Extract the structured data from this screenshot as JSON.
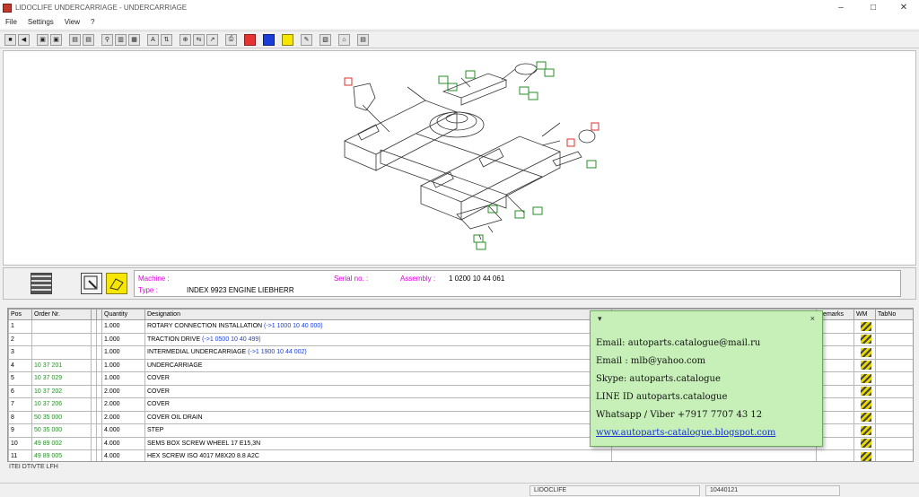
{
  "window": {
    "title": "LIDOCLIFE UNDERCARRIAGE - UNDERCARRIAGE",
    "minimize": "–",
    "maximize": "□",
    "close": "✕"
  },
  "menu": [
    "File",
    "Settings",
    "View",
    "?"
  ],
  "toolbar": {
    "groups": [
      [
        "■",
        "◀"
      ],
      [
        "▣",
        "▣"
      ],
      [
        "▤",
        "▤"
      ],
      [
        "⚲",
        "▥",
        "▦"
      ],
      [
        "A",
        "⇅"
      ],
      [
        "⊕",
        "⇆",
        "↗"
      ],
      [
        "⎙"
      ],
      [
        "red"
      ],
      [
        "blue"
      ],
      [
        "yellow"
      ],
      [
        "✎"
      ],
      [
        "▧"
      ],
      [
        "⌂"
      ],
      [
        "▤"
      ]
    ]
  },
  "info": {
    "machine_label": "Machine :",
    "machine_value": "",
    "serial_label": "Serial no. :",
    "assembly_label": "Assembly :",
    "assembly_value": "1 0200 10 44 061",
    "type_label": "Type :",
    "type_value": "INDEX 9923 ENGINE LIEBHERR"
  },
  "table": {
    "headers": [
      "Pos",
      "Order Nr.",
      "",
      "",
      "Quantity",
      "Designation",
      "",
      "Remarks",
      "WM",
      "TabNo"
    ],
    "rows": [
      {
        "pos": "1",
        "order": "",
        "qty": "1.000",
        "desc": "ROTARY CONNECTION INSTALLATION",
        "link": "(->1 1000 10 40 000)"
      },
      {
        "pos": "2",
        "order": "",
        "qty": "1.000",
        "desc": "TRACTION DRIVE",
        "link": "(->1 0500 10 40 499)"
      },
      {
        "pos": "3",
        "order": "",
        "qty": "1.000",
        "desc": "INTERMEDIAL UNDERCARRIAGE",
        "link": "(->1 1900 10 44 002)"
      },
      {
        "pos": "4",
        "order": "10 37 201",
        "qty": "1.000",
        "desc": "UNDERCARRIAGE",
        "link": ""
      },
      {
        "pos": "5",
        "order": "10 37 029",
        "qty": "1.000",
        "desc": "COVER",
        "link": ""
      },
      {
        "pos": "6",
        "order": "10 37 202",
        "qty": "2.000",
        "desc": "COVER",
        "link": ""
      },
      {
        "pos": "7",
        "order": "10 37 206",
        "qty": "2.000",
        "desc": "COVER",
        "link": ""
      },
      {
        "pos": "8",
        "order": "50 35 000",
        "qty": "2.000",
        "desc": "COVER OIL DRAIN",
        "link": ""
      },
      {
        "pos": "9",
        "order": "50 35 000",
        "qty": "4.000",
        "desc": "STEP",
        "link": ""
      },
      {
        "pos": "10",
        "order": "49 89 002",
        "qty": "4.000",
        "desc": "SEMS BOX SCREW WHEEL 17 E15,3N",
        "link": ""
      },
      {
        "pos": "11",
        "order": "49 89 005",
        "qty": "4.000",
        "desc": "HEX SCREW ISO 4017 M8X20 8.8 A2C",
        "link": ""
      }
    ]
  },
  "footer_text": "ITEI DTIVTE LFH",
  "status": {
    "center": "LIDOCLIFE",
    "right": "10440121"
  },
  "popup": {
    "close": "×",
    "pin": "▾",
    "lines": [
      "Email: autoparts.catalogue@mail.ru",
      "Email : mlb@yahoo.com",
      "Skype: autoparts.catalogue",
      "LINE ID autoparts.catalogue",
      "Whatsapp / Viber +7917 7707 43 12"
    ],
    "link": "www.autoparts-catalogue.blogspot.com"
  }
}
